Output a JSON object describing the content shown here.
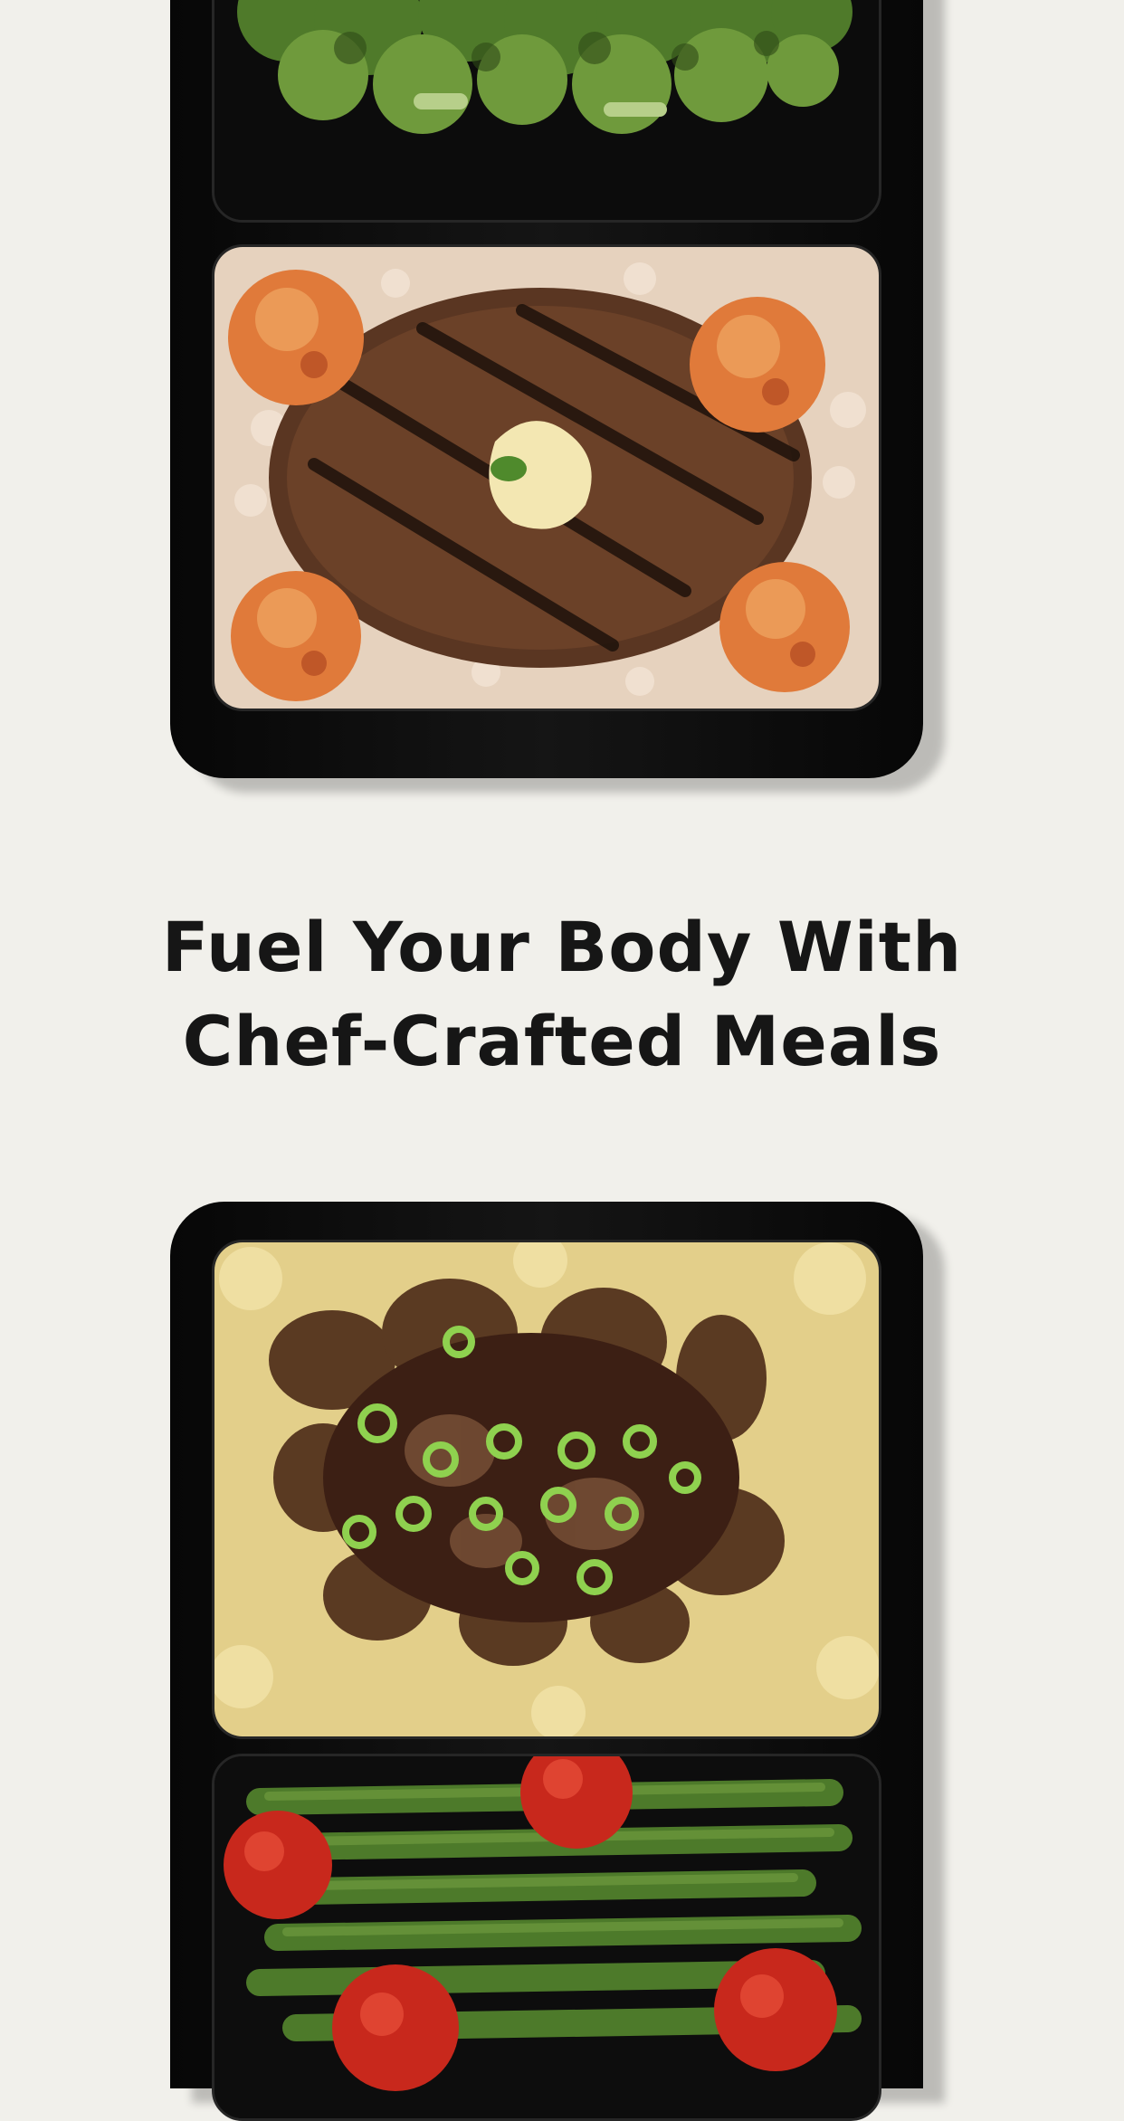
{
  "hero": {
    "title_line1": "Fuel Your Body With",
    "title_line2": "Chef-Crafted Meals"
  },
  "colors": {
    "background": "#f1f0eb",
    "title_text": "#161616",
    "tray": "#0d0d0d"
  },
  "images": {
    "top_meal_upper": "broccoli",
    "top_meal_lower": "grilled-steak-shrimp-risotto",
    "bottom_meal_upper": "mushrooms-mashed-potatoes",
    "bottom_meal_lower": "green-beans-tomatoes"
  }
}
